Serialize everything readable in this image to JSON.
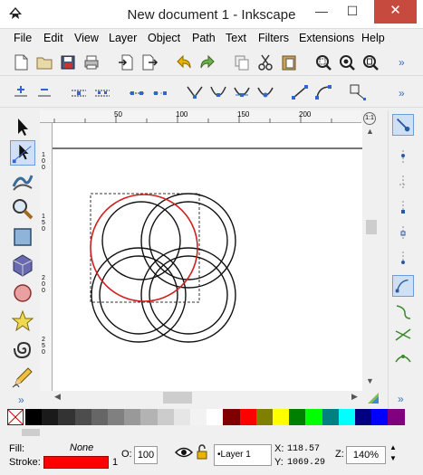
{
  "window": {
    "title": "New document 1 - Inkscape",
    "minimize_glyph": "—",
    "maximize_glyph": "☐",
    "close_glyph": "✕"
  },
  "menu": [
    "File",
    "Edit",
    "View",
    "Layer",
    "Object",
    "Path",
    "Text",
    "Filters",
    "Extensions",
    "Help"
  ],
  "toolbar": {
    "more_glyph": "»",
    "commands": [
      "new-document-icon",
      "open-icon",
      "save-icon",
      "print-icon",
      "import-icon",
      "export-icon",
      "undo-icon",
      "redo-icon",
      "duplicate-icon",
      "cut-icon",
      "paste-icon",
      "zoom-selection-icon",
      "zoom-drawing-icon",
      "zoom-page-icon"
    ],
    "node_tools": [
      "insert-node-icon",
      "delete-node-icon",
      "join-nodes-icon",
      "break-path-icon",
      "join-segment-icon",
      "delete-segment-icon",
      "make-cusp-icon",
      "make-smooth-icon",
      "make-symmetric-icon",
      "auto-smooth-icon",
      "make-line-icon",
      "make-curve-icon",
      "object-to-path-icon"
    ]
  },
  "tools": [
    "selector-icon",
    "node-editor-icon",
    "tweak-icon",
    "zoom-icon",
    "rectangle-icon",
    "3d-box-icon",
    "ellipse-icon",
    "star-icon",
    "spiral-icon",
    "pencil-icon"
  ],
  "ruler": {
    "h_ticks": [
      "50",
      "100",
      "150",
      "200"
    ],
    "v_ticks": [
      "1\n0\n0",
      "1\n5\n0",
      "2\n0\n0",
      "2\n5\n0",
      "3\n0\n0"
    ],
    "zoom_correction": "1:1"
  },
  "palette": {
    "colors": [
      "#000000",
      "#1a1a1a",
      "#333333",
      "#4d4d4d",
      "#666666",
      "#808080",
      "#999999",
      "#b3b3b3",
      "#cccccc",
      "#e6e6e6",
      "#f2f2f2",
      "#ffffff",
      "#800000",
      "#ff0000",
      "#808000",
      "#ffff00",
      "#008000",
      "#00ff00",
      "#008080",
      "#00ffff",
      "#000080",
      "#0000ff",
      "#800080"
    ]
  },
  "status": {
    "fill_label": "Fill:",
    "fill_value": "None",
    "stroke_label": "Stroke:",
    "stroke_width": "1",
    "stroke_color": "#ff0000",
    "opacity_label": "O:",
    "opacity_value": "100",
    "layer_name": "•Layer 1",
    "x_label": "X:",
    "x_value": "118.57",
    "y_label": "Y:",
    "y_value": "1069.29",
    "zoom_label": "Z:",
    "zoom_value": "140%"
  }
}
